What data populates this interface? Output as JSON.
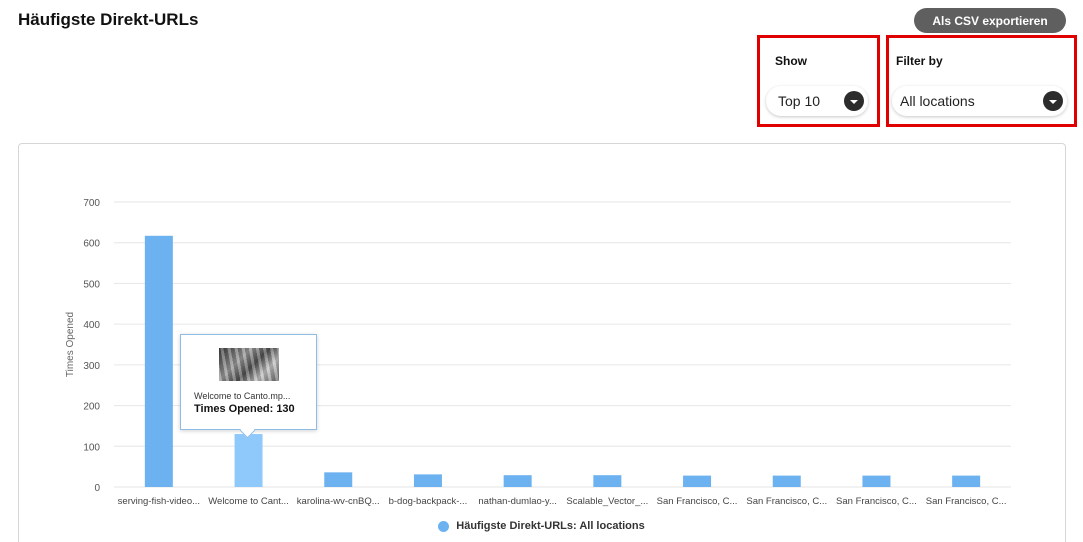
{
  "header": {
    "title": "Häufigste Direkt-URLs",
    "export_label": "Als CSV exportieren"
  },
  "filters": {
    "show": {
      "label": "Show",
      "value": "Top 10"
    },
    "filter_by": {
      "label": "Filter by",
      "value": "All locations"
    }
  },
  "tooltip": {
    "name": "Welcome to Canto.mp...",
    "value_text": "Times Opened: 130"
  },
  "legend": {
    "label": "Häufigste Direkt-URLs: All locations"
  },
  "colors": {
    "bar": "#6cb2f0",
    "bar_highlight": "#8fc9fb",
    "grid": "#e6e6e6",
    "highlight_box": "#e00000"
  },
  "chart_data": {
    "type": "bar",
    "ylabel": "Times Opened",
    "xlabel": "",
    "ylim": [
      0,
      700
    ],
    "yticks": [
      0,
      100,
      200,
      300,
      400,
      500,
      600,
      700
    ],
    "grid": true,
    "legend_position": "bottom",
    "highlighted_index": 1,
    "categories": [
      "serving-fish-video...",
      "Welcome to Cant...",
      "karolina-wv-cnBQ...",
      "b-dog-backpack-...",
      "nathan-dumlao-y...",
      "Scalable_Vector_...",
      "San Francisco, C...",
      "San Francisco, C...",
      "San Francisco, C...",
      "San Francisco, C..."
    ],
    "series": [
      {
        "name": "Häufigste Direkt-URLs: All locations",
        "values": [
          617,
          130,
          36,
          31,
          29,
          29,
          28,
          28,
          28,
          28
        ]
      }
    ]
  }
}
